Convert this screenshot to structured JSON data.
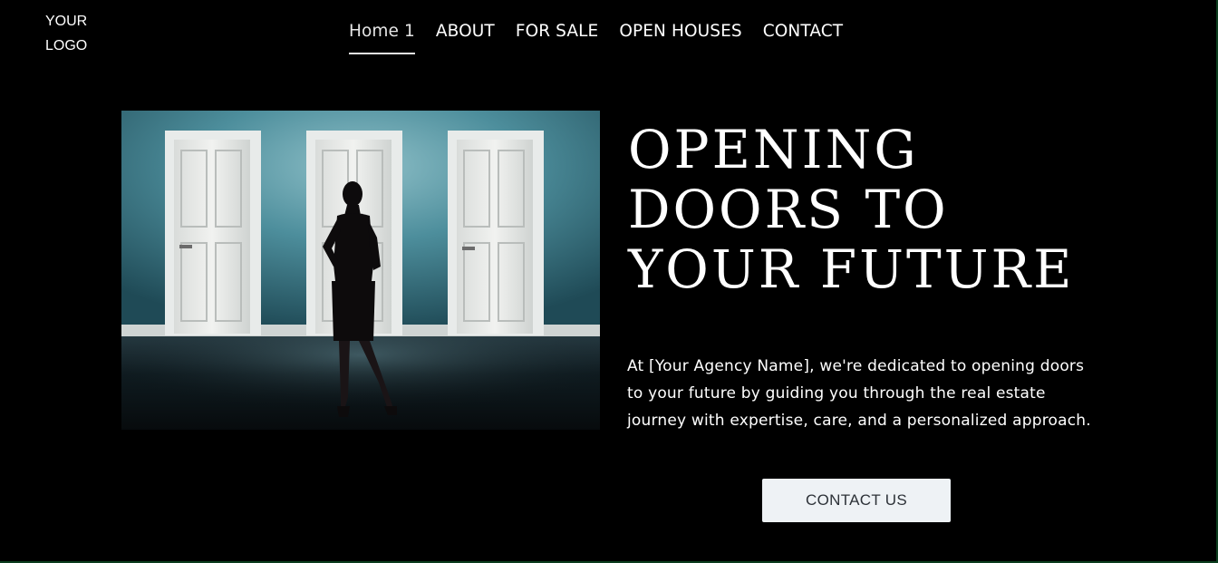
{
  "header": {
    "logo_text": "YOUR\nLOGO",
    "nav": [
      {
        "label": "Home 1",
        "active": true
      },
      {
        "label": "ABOUT",
        "active": false
      },
      {
        "label": "FOR SALE",
        "active": false
      },
      {
        "label": "OPEN HOUSES",
        "active": false
      },
      {
        "label": "CONTACT",
        "active": false
      }
    ]
  },
  "hero": {
    "image_subject": "woman-facing-three-white-doors",
    "headline_lines": [
      "OPENING",
      "DOORS TO",
      "YOUR FUTURE"
    ],
    "description": "At [Your Agency Name], we're dedicated to opening doors to your future by guiding you through the real estate journey with expertise, care, and a personalized approach.",
    "cta_label": "CONTACT US"
  },
  "colors": {
    "background": "#000000",
    "wall": "#4a8a98",
    "door": "#e6e8e6",
    "button_bg": "#eef2f5",
    "button_text": "#2d3238"
  }
}
